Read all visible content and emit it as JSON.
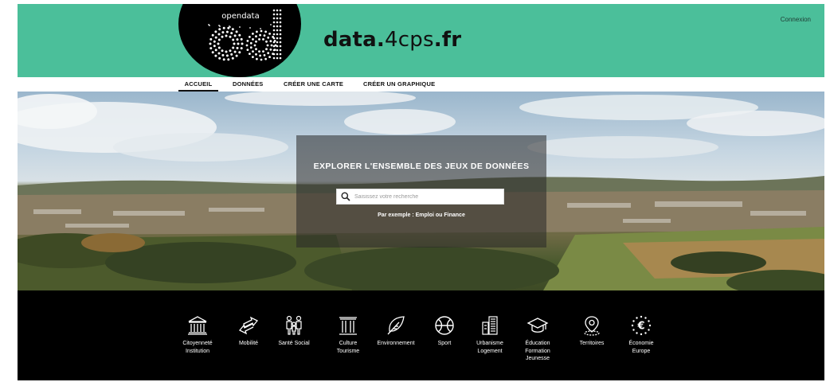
{
  "header": {
    "logo_text": "opendata",
    "site_name_bold": "data.",
    "site_name_light": "4cps",
    "site_name_tld": ".fr",
    "login_label": "Connexion"
  },
  "nav": [
    {
      "label": "ACCUEIL",
      "active": true
    },
    {
      "label": "DONNÉES",
      "active": false
    },
    {
      "label": "CRÉER UNE CARTE",
      "active": false
    },
    {
      "label": "CRÉER UN GRAPHIQUE",
      "active": false
    }
  ],
  "search": {
    "heading": "EXPLORER L'ENSEMBLE DES JEUX DE DONNÉES",
    "placeholder": "Saisissez votre recherche",
    "value": "",
    "example": "Par exemple : Emploi ou Finance"
  },
  "themes": [
    {
      "icon": "institution-icon",
      "lines": [
        "Citoyenneté",
        "Institution"
      ]
    },
    {
      "icon": "mobility-arrows-icon",
      "lines": [
        "Mobilité"
      ]
    },
    {
      "icon": "family-icon",
      "lines": [
        "Santé Social"
      ]
    },
    {
      "icon": "columns-icon",
      "lines": [
        "Culture",
        "Tourisme"
      ]
    },
    {
      "icon": "leaf-icon",
      "lines": [
        "Environnement"
      ]
    },
    {
      "icon": "ball-icon",
      "lines": [
        "Sport"
      ]
    },
    {
      "icon": "buildings-icon",
      "lines": [
        "Urbanisme",
        "Logement"
      ]
    },
    {
      "icon": "graduation-cap-icon",
      "lines": [
        "Éducation",
        "Formation",
        "Jeunesse"
      ]
    },
    {
      "icon": "map-pin-icon",
      "lines": [
        "Territoires"
      ]
    },
    {
      "icon": "euro-stars-icon",
      "lines": [
        "Économie",
        "Europe"
      ]
    }
  ],
  "colors": {
    "header_green": "#4bbf9a",
    "theme_bar": "#000000"
  }
}
